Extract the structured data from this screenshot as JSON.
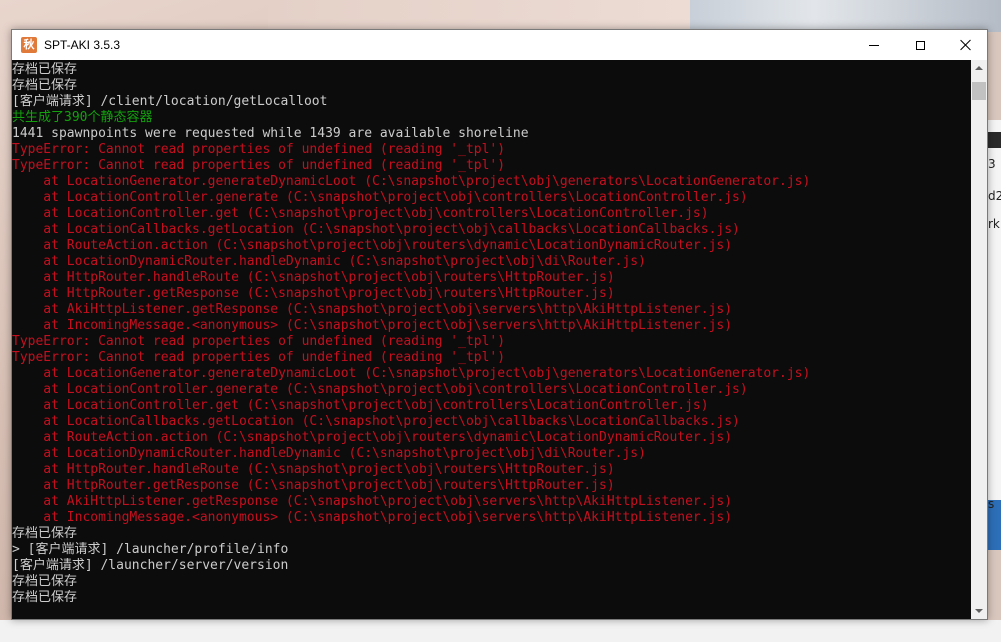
{
  "window": {
    "title": "SPT-AKI 3.5.3",
    "icon": "app-icon",
    "icon_glyph": "秋"
  },
  "background_peek": [
    "3",
    "d2",
    "rk",
    "s"
  ],
  "colors": {
    "console_bg": "#0c0c0c",
    "text_default": "#cccccc",
    "text_success": "#13a10e",
    "text_error": "#c50f1f"
  },
  "console": {
    "lines": [
      {
        "text": "存档已保存",
        "color": "white"
      },
      {
        "text": "存档已保存",
        "color": "white"
      },
      {
        "text": "[客户端请求] /client/location/getLocalloot",
        "color": "white"
      },
      {
        "text": "共生成了390个静态容器",
        "color": "green"
      },
      {
        "text": "1441 spawnpoints were requested while 1439 are available shoreline",
        "color": "white"
      },
      {
        "text": "TypeError: Cannot read properties of undefined (reading '_tpl')",
        "color": "red"
      },
      {
        "text": "TypeError: Cannot read properties of undefined (reading '_tpl')",
        "color": "red"
      },
      {
        "text": "    at LocationGenerator.generateDynamicLoot (C:\\snapshot\\project\\obj\\generators\\LocationGenerator.js)",
        "color": "red"
      },
      {
        "text": "    at LocationController.generate (C:\\snapshot\\project\\obj\\controllers\\LocationController.js)",
        "color": "red"
      },
      {
        "text": "    at LocationController.get (C:\\snapshot\\project\\obj\\controllers\\LocationController.js)",
        "color": "red"
      },
      {
        "text": "    at LocationCallbacks.getLocation (C:\\snapshot\\project\\obj\\callbacks\\LocationCallbacks.js)",
        "color": "red"
      },
      {
        "text": "    at RouteAction.action (C:\\snapshot\\project\\obj\\routers\\dynamic\\LocationDynamicRouter.js)",
        "color": "red"
      },
      {
        "text": "    at LocationDynamicRouter.handleDynamic (C:\\snapshot\\project\\obj\\di\\Router.js)",
        "color": "red"
      },
      {
        "text": "    at HttpRouter.handleRoute (C:\\snapshot\\project\\obj\\routers\\HttpRouter.js)",
        "color": "red"
      },
      {
        "text": "    at HttpRouter.getResponse (C:\\snapshot\\project\\obj\\routers\\HttpRouter.js)",
        "color": "red"
      },
      {
        "text": "    at AkiHttpListener.getResponse (C:\\snapshot\\project\\obj\\servers\\http\\AkiHttpListener.js)",
        "color": "red"
      },
      {
        "text": "    at IncomingMessage.<anonymous> (C:\\snapshot\\project\\obj\\servers\\http\\AkiHttpListener.js)",
        "color": "red"
      },
      {
        "text": "TypeError: Cannot read properties of undefined (reading '_tpl')",
        "color": "red"
      },
      {
        "text": "TypeError: Cannot read properties of undefined (reading '_tpl')",
        "color": "red"
      },
      {
        "text": "    at LocationGenerator.generateDynamicLoot (C:\\snapshot\\project\\obj\\generators\\LocationGenerator.js)",
        "color": "red"
      },
      {
        "text": "    at LocationController.generate (C:\\snapshot\\project\\obj\\controllers\\LocationController.js)",
        "color": "red"
      },
      {
        "text": "    at LocationController.get (C:\\snapshot\\project\\obj\\controllers\\LocationController.js)",
        "color": "red"
      },
      {
        "text": "    at LocationCallbacks.getLocation (C:\\snapshot\\project\\obj\\callbacks\\LocationCallbacks.js)",
        "color": "red"
      },
      {
        "text": "    at RouteAction.action (C:\\snapshot\\project\\obj\\routers\\dynamic\\LocationDynamicRouter.js)",
        "color": "red"
      },
      {
        "text": "    at LocationDynamicRouter.handleDynamic (C:\\snapshot\\project\\obj\\di\\Router.js)",
        "color": "red"
      },
      {
        "text": "    at HttpRouter.handleRoute (C:\\snapshot\\project\\obj\\routers\\HttpRouter.js)",
        "color": "red"
      },
      {
        "text": "    at HttpRouter.getResponse (C:\\snapshot\\project\\obj\\routers\\HttpRouter.js)",
        "color": "red"
      },
      {
        "text": "    at AkiHttpListener.getResponse (C:\\snapshot\\project\\obj\\servers\\http\\AkiHttpListener.js)",
        "color": "red"
      },
      {
        "text": "    at IncomingMessage.<anonymous> (C:\\snapshot\\project\\obj\\servers\\http\\AkiHttpListener.js)",
        "color": "red"
      },
      {
        "text": "存档已保存",
        "color": "white"
      },
      {
        "text": "> [客户端请求] /launcher/profile/info",
        "color": "white"
      },
      {
        "text": "[客户端请求] /launcher/server/version",
        "color": "white"
      },
      {
        "text": "存档已保存",
        "color": "white"
      },
      {
        "text": "存档已保存",
        "color": "white"
      }
    ]
  }
}
